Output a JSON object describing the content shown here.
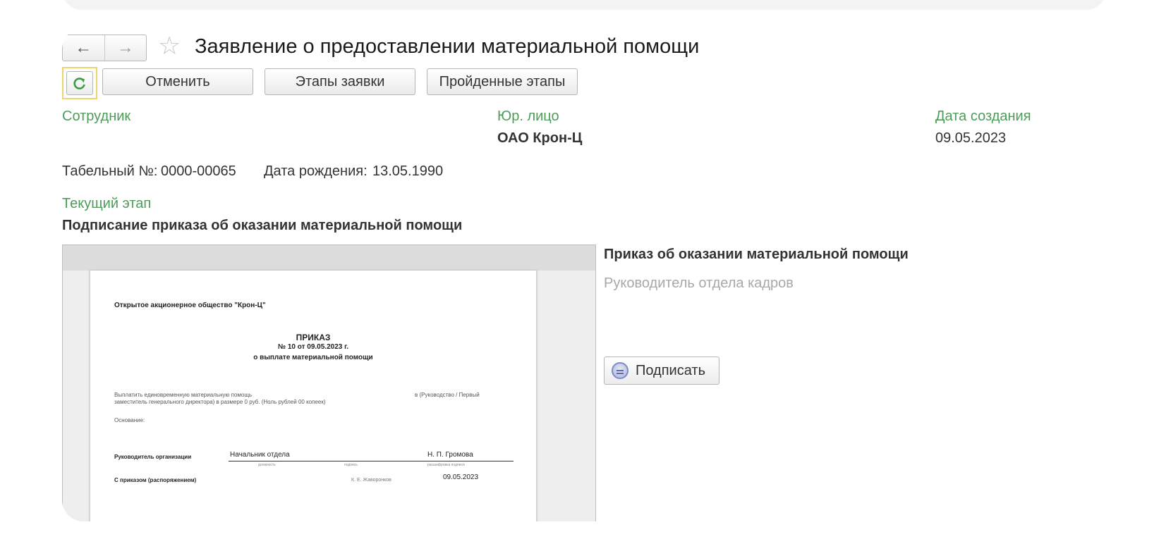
{
  "header": {
    "back_icon": "arrow-left-icon",
    "forward_icon": "arrow-right-icon",
    "favorite_icon": "star-icon",
    "title": "Заявление о предоставлении материальной помощи"
  },
  "toolbar": {
    "refresh_icon": "refresh-icon",
    "cancel_label": "Отменить",
    "stages_label": "Этапы заявки",
    "passed_stages_label": "Пройденные этапы"
  },
  "fields": {
    "employee_label": "Сотрудник",
    "legal_entity_label": "Юр. лицо",
    "legal_entity_value": "ОАО Крон-Ц",
    "created_label": "Дата создания",
    "created_value": "09.05.2023",
    "personnel_no_label": "Табельный №:",
    "personnel_no_value": "0000-00065",
    "birth_date_label": "Дата рождения:",
    "birth_date_value": "13.05.1990",
    "current_stage_label": "Текущий этап",
    "current_stage_value": "Подписание приказа об оказании материальной помощи"
  },
  "document": {
    "company": "Открытое акционерное общество \"Крон-Ц\"",
    "heading": "ПРИКАЗ",
    "number_line": "№ 10 от 09.05.2023 г.",
    "subject": "о выплате материальной помощи",
    "body_line1": "Выплатить единовременную материальную помощь",
    "body_line1_right": "в (Руководство / Первый",
    "body_line2": "заместитель генерального директора) в размере 0 руб. (Ноль рублей 00 копеек)",
    "basis": "Основание:",
    "head_label": "Руководитель организации",
    "head_position": "Начальник отдела",
    "head_name": "Н. П. Громова",
    "caption_position": "должность",
    "caption_signature": "подпись",
    "caption_decoding": "расшифровка подписи",
    "acquainted_label": "С приказом (распоряжением)",
    "acquainted_name": "К. Е. Жаворонков",
    "acquainted_date": "09.05.2023"
  },
  "side_panel": {
    "title": "Приказ об оказании материальной помощи",
    "role": "Руководитель отдела кадров",
    "sign_label": "Подписать",
    "sign_icon": "sign-icon"
  }
}
